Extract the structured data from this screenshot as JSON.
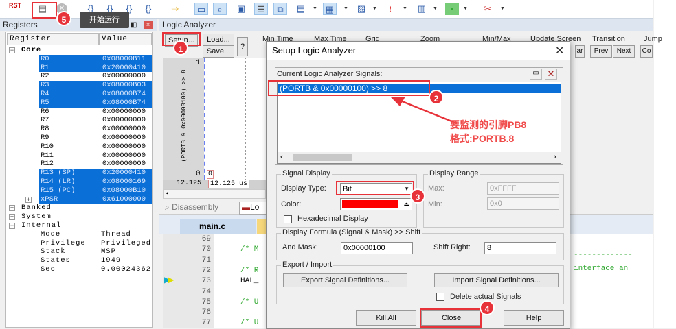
{
  "toolbar": {
    "rst_label": "RST",
    "icons": [
      "reset-icon",
      "run-icon",
      "stop-icon",
      "step-into-icon",
      "step-over-icon",
      "step-out-icon",
      "run-to-cursor-icon",
      "show-next-statement-icon",
      "command-window-icon",
      "disassembly-window-icon",
      "symbols-window-icon",
      "registers-window-icon",
      "call-stack-icon",
      "watch-windows-icon",
      "memory-windows-icon",
      "serial-windows-icon",
      "analysis-windows-icon",
      "trace-windows-icon",
      "system-viewer-icon",
      "toolbox-icon"
    ],
    "tooltip": "开始运行"
  },
  "registers": {
    "title": "Registers",
    "col_register": "Register",
    "col_value": "Value",
    "core_label": "Core",
    "core": [
      {
        "name": "R0",
        "value": "0x08000B11",
        "sel": true
      },
      {
        "name": "R1",
        "value": "0x20000410",
        "sel": true
      },
      {
        "name": "R2",
        "value": "0x00000000",
        "sel": false
      },
      {
        "name": "R3",
        "value": "0x08000B03",
        "sel": true
      },
      {
        "name": "R4",
        "value": "0x08000B74",
        "sel": true
      },
      {
        "name": "R5",
        "value": "0x08000B74",
        "sel": true
      },
      {
        "name": "R6",
        "value": "0x00000000",
        "sel": false
      },
      {
        "name": "R7",
        "value": "0x00000000",
        "sel": false
      },
      {
        "name": "R8",
        "value": "0x00000000",
        "sel": false
      },
      {
        "name": "R9",
        "value": "0x00000000",
        "sel": false
      },
      {
        "name": "R10",
        "value": "0x00000000",
        "sel": false
      },
      {
        "name": "R11",
        "value": "0x00000000",
        "sel": false
      },
      {
        "name": "R12",
        "value": "0x00000000",
        "sel": false
      },
      {
        "name": "R13 (SP)",
        "value": "0x20000410",
        "sel": true
      },
      {
        "name": "R14 (LR)",
        "value": "0x08000169",
        "sel": true
      },
      {
        "name": "R15 (PC)",
        "value": "0x08000B10",
        "sel": true
      },
      {
        "name": "xPSR",
        "value": "0x61000000",
        "sel": true
      }
    ],
    "groups": [
      "Banked",
      "System",
      "Internal"
    ],
    "internal": [
      {
        "name": "Mode",
        "value": "Thread"
      },
      {
        "name": "Privilege",
        "value": "Privileged"
      },
      {
        "name": "Stack",
        "value": "MSP"
      },
      {
        "name": "States",
        "value": "1949"
      },
      {
        "name": "Sec",
        "value": "0.00024362"
      }
    ]
  },
  "logic": {
    "title": "Logic Analyzer",
    "setup": "Setup...",
    "load": "Load...",
    "save": "Save...",
    "help": "?",
    "headers": [
      "Min Time",
      "Max Time",
      "Grid",
      "Zoom",
      "Min/Max",
      "Update Screen",
      "Transition",
      "Jump"
    ],
    "clear": "ar",
    "prev": "Prev",
    "next": "Next",
    "code": "Co",
    "signal_label": "(PORTB & 0x00000100) >> 8",
    "y_max": "1",
    "y_min": "0",
    "cursor_value": "0",
    "time_left": "12.125",
    "time_cursor": "12.125 us"
  },
  "tabs": {
    "disassembly": "Disassembly",
    "logic": "Lo",
    "file": "main.c"
  },
  "code": {
    "lines": [
      "69",
      "70",
      "71",
      "72",
      "73",
      "74",
      "75",
      "76",
      "77"
    ],
    "text": {
      "70": "/* M",
      "72": "/* R",
      "73": "HAL_",
      "75": "/* U",
      "77": "/* U"
    },
    "right_dashes": "-------------",
    "right_text": "interface an"
  },
  "dialog": {
    "title": "Setup Logic Analyzer",
    "signals_label": "Current Logic Analyzer Signals:",
    "signals": [
      "(PORTB & 0x00000100) >> 8"
    ],
    "signal_display": "Signal Display",
    "display_type_label": "Display Type:",
    "display_type": "Bit",
    "color_label": "Color:",
    "signal_color": "#ff0000",
    "hex_label": "Hexadecimal Display",
    "hex_checked": false,
    "display_range": "Display Range",
    "max_label": "Max:",
    "max": "0xFFFF",
    "min_label": "Min:",
    "min": "0x0",
    "formula": "Display Formula (Signal & Mask) >> Shift",
    "mask_label": "And Mask:",
    "mask": "0x00000100",
    "shift_label": "Shift Right:",
    "shift": "8",
    "export_import": "Export / Import",
    "export": "Export Signal Definitions...",
    "import": "Import Signal Definitions...",
    "delete_label": "Delete actual Signals",
    "delete_checked": false,
    "kill_all": "Kill All",
    "close": "Close",
    "help": "Help"
  },
  "annotations": {
    "badges": [
      "1",
      "2",
      "3",
      "4",
      "5"
    ],
    "note_line1": "要监测的引脚PB8",
    "note_line2": "格式:PORTB.8",
    "color": "#e8323a"
  }
}
